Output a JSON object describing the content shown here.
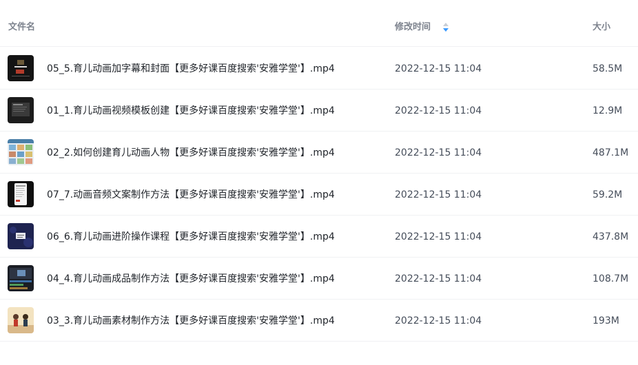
{
  "header": {
    "name_label": "文件名",
    "time_label": "修改时间",
    "size_label": "大小",
    "sort_icon": "sort-descending-icon"
  },
  "colors": {
    "header_text": "#7d838e",
    "sort_active": "#3b9bff",
    "divider": "#f0f1f3"
  },
  "files": [
    {
      "name": "05_5.育儿动画加字幕和封面【更多好课百度搜索'安雅学堂'】.mp4",
      "modified": "2022-12-15 11:04",
      "size": "58.5M",
      "thumb": "video-thumbnail"
    },
    {
      "name": "01_1.育儿动画视频模板创建【更多好课百度搜索'安雅学堂'】.mp4",
      "modified": "2022-12-15 11:04",
      "size": "12.9M",
      "thumb": "video-thumbnail"
    },
    {
      "name": "02_2.如何创建育儿动画人物【更多好课百度搜索'安雅学堂'】.mp4",
      "modified": "2022-12-15 11:04",
      "size": "487.1M",
      "thumb": "video-thumbnail"
    },
    {
      "name": "07_7.动画音频文案制作方法【更多好课百度搜索'安雅学堂'】.mp4",
      "modified": "2022-12-15 11:04",
      "size": "59.2M",
      "thumb": "video-thumbnail"
    },
    {
      "name": "06_6.育儿动画进阶操作课程【更多好课百度搜索'安雅学堂'】.mp4",
      "modified": "2022-12-15 11:04",
      "size": "437.8M",
      "thumb": "video-thumbnail"
    },
    {
      "name": "04_4.育儿动画成品制作方法【更多好课百度搜索'安雅学堂'】.mp4",
      "modified": "2022-12-15 11:04",
      "size": "108.7M",
      "thumb": "video-thumbnail"
    },
    {
      "name": "03_3.育儿动画素材制作方法【更多好课百度搜索'安雅学堂'】.mp4",
      "modified": "2022-12-15 11:04",
      "size": "193M",
      "thumb": "video-thumbnail"
    }
  ]
}
